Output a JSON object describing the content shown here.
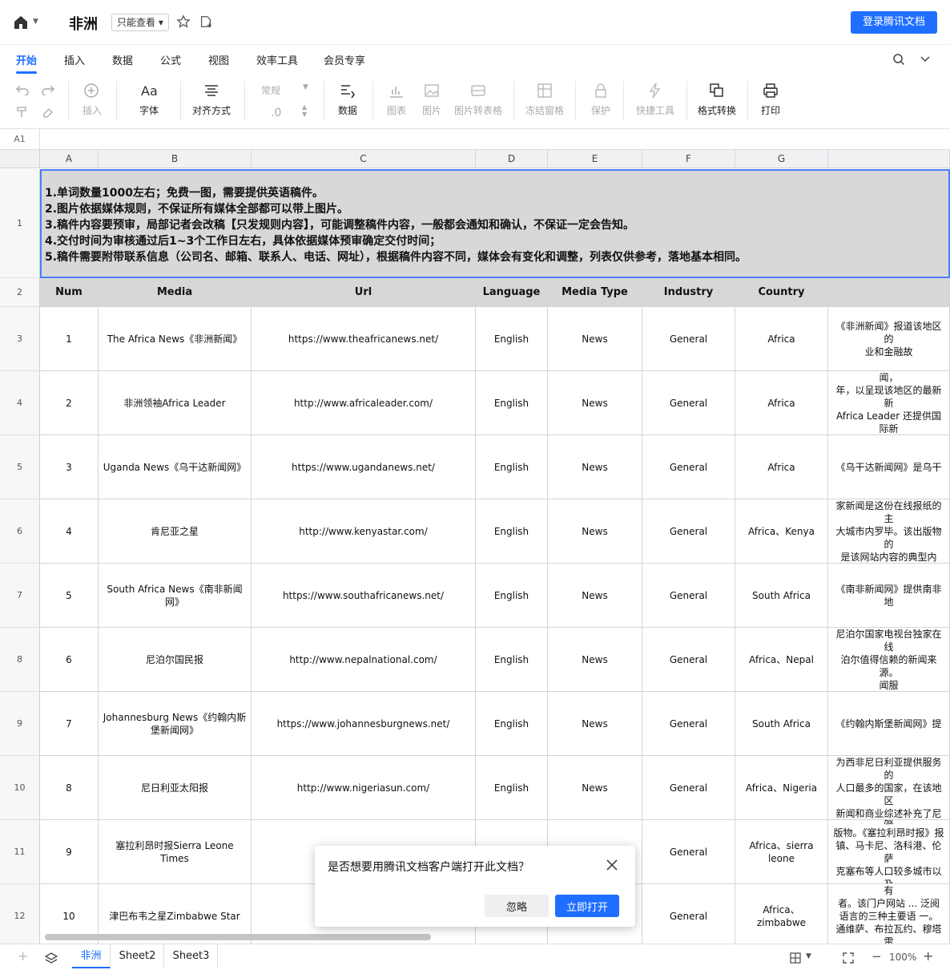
{
  "titlebar": {
    "doc_title": "非洲",
    "mode": "只能查看 ▾",
    "login": "登录腾讯文档"
  },
  "menu": {
    "tabs": [
      "开始",
      "插入",
      "数据",
      "公式",
      "视图",
      "效率工具",
      "会员专享"
    ]
  },
  "toolbar": {
    "insert": "插入",
    "font": "字体",
    "align": "对齐方式",
    "format_value": "常规",
    "decimal": ".0",
    "data": "数据",
    "chart": "图表",
    "image": "图片",
    "image_to_table": "图片转表格",
    "freeze": "冻结窗格",
    "protect": "保护",
    "quick_tools": "快捷工具",
    "format_convert": "格式转换",
    "print": "打印"
  },
  "formula_bar": {
    "cell_ref": "A1"
  },
  "columns": [
    "A",
    "B",
    "C",
    "D",
    "E",
    "F",
    "G"
  ],
  "notes": [
    "1.单词数量1000左右；免费一图，需要提供英语稿件。",
    "2.图片依据媒体规则，不保证所有媒体全部都可以带上图片。",
    "3.稿件内容要预审，局部记者会改稿【只发规则内容】，可能调整稿件内容，一般都会通知和确认，不保证一定会告知。",
    "4.交付时间为审核通过后1~3个工作日左右，具体依据媒体预审确定交付时间；",
    "5.稿件需要附带联系信息（公司名、邮箱、联系人、电话、网址），根据稿件内容不同，媒体会有变化和调整，列表仅供参考，落地基本相同。"
  ],
  "headers": [
    "Num",
    "Media",
    "Url",
    "Language",
    "Media Type",
    "Industry",
    "Country"
  ],
  "rows": [
    {
      "row": "3",
      "num": "1",
      "media": "The Africa News《非洲新闻》",
      "url": "https://www.theafricanews.net/",
      "lang": "English",
      "type": "News",
      "industry": "General",
      "country": "Africa",
      "desc": "《非洲新闻》报道该地区的\n业和金融故"
    },
    {
      "row": "4",
      "num": "2",
      "media": "非洲领袖Africa Leader",
      "url": "http://www.africaleader.com/",
      "lang": "English",
      "type": "News",
      "industry": "General",
      "country": "Africa",
      "desc": "来自非洲大陆各地的新闻，\n年，以呈现该地区的最新新\nAfrica Leader 还提供国际新\n中非"
    },
    {
      "row": "5",
      "num": "3",
      "media": "Uganda News《乌干达新闻网》",
      "url": "https://www.ugandanews.net/",
      "lang": "English",
      "type": "News",
      "industry": "General",
      "country": "Africa",
      "desc": "《乌干达新闻网》是乌干"
    },
    {
      "row": "6",
      "num": "4",
      "media": "肯尼亚之星",
      "url": "http://www.kenyastar.com/",
      "lang": "English",
      "type": "News",
      "industry": "General",
      "country": "Africa、Kenya",
      "desc": "面向非洲东南部非洲大湖地\n家新闻是这份在线报纸的主\n大城市内罗毕。该出版物的\n是该网站内容的典型内容。\n新闻，以及有关"
    },
    {
      "row": "7",
      "num": "5",
      "media": "South Africa News《南非新闻网》",
      "url": "https://www.southafricanews.net/",
      "lang": "English",
      "type": "News",
      "industry": "General",
      "country": "South Africa",
      "desc": "《南非新闻网》提供南非地"
    },
    {
      "row": "8",
      "num": "6",
      "media": "尼泊尔国民报",
      "url": "http://www.nepalnational.com/",
      "lang": "English",
      "type": "News",
      "industry": "General",
      "country": "Africa、Nepal",
      "desc": "尼泊尔国家电视台独家在线\n泊尔值得信赖的新闻来源。\n闻服"
    },
    {
      "row": "9",
      "num": "7",
      "media": "Johannesburg News《约翰内斯堡新闻网》",
      "url": "https://www.johannesburgnews.net/",
      "lang": "English",
      "type": "News",
      "industry": "General",
      "country": "South Africa",
      "desc": "《约翰内斯堡新闻网》提"
    },
    {
      "row": "10",
      "num": "8",
      "media": "尼日利亚太阳报",
      "url": "http://www.nigeriasun.com/",
      "lang": "English",
      "type": "News",
      "industry": "General",
      "country": "Africa、Nigeria",
      "desc": "尼日利亚太阳报 (Nigeria Su\n为西非尼日利亚提供服务的\n人口最多的国家，在该地区\n新闻和商业综述补充了尼日\n各斯、卡诺、伊巴"
    },
    {
      "row": "11",
      "num": "9",
      "media": "塞拉利昂时报Sierra Leone Times",
      "url": "http://",
      "lang": "",
      "type": "",
      "industry": "General",
      "country": "Africa、sierra leone",
      "desc": "塞拉利昂第一个在线新闻服\n版物。《塞拉利昂时报》报\n镇、马卡尼、洛科港、伦萨\n克塞布等人口较多城市以及\n家"
    },
    {
      "row": "12",
      "num": "10",
      "media": "津巴布韦之星Zimbabwe Star",
      "url": "http:",
      "lang": "",
      "type": "",
      "industry": "General",
      "country": "Africa、zimbabwe",
      "desc": "《津巴布韦之星》一直是有\n者。该门户网站 ... 泛阅\n语言的三种主要语 一。\n通维萨、布拉瓦约、穆塔雷\n哈拉雷等大"
    }
  ],
  "dialog": {
    "message": "是否想要用腾讯文档客户端打开此文档？",
    "ignore": "忽略",
    "open": "立即打开"
  },
  "sheets": [
    "非洲",
    "Sheet2",
    "Sheet3"
  ],
  "zoom": "100%",
  "colors": {
    "accent": "#1e6fff",
    "header_fill": "#d7d7d7"
  }
}
